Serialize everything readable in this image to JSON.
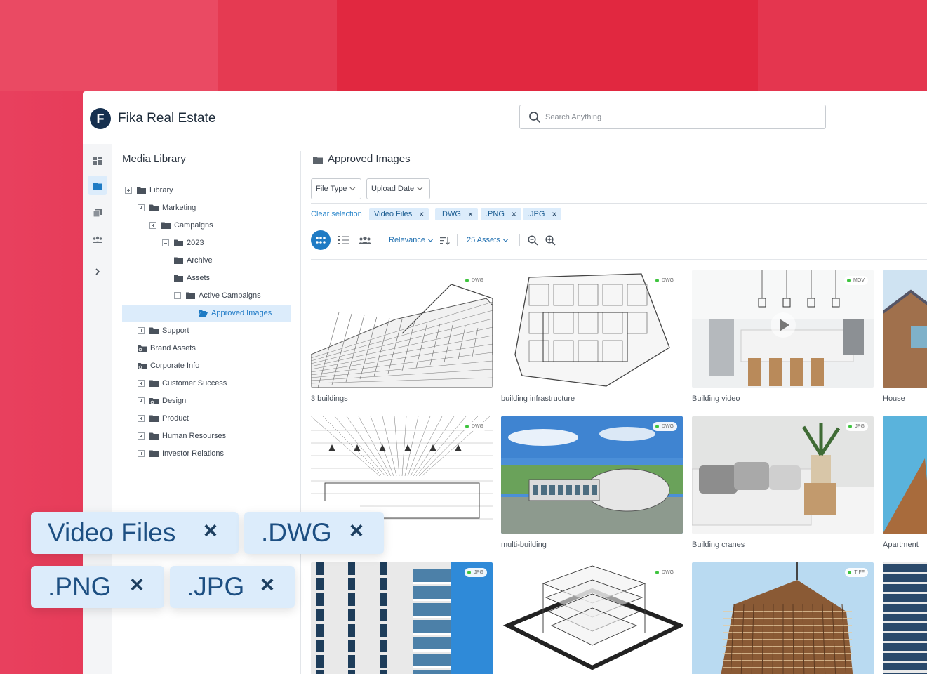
{
  "app": {
    "logo_letter": "F",
    "brand": "Fika Real Estate"
  },
  "search": {
    "placeholder": "Search Anything"
  },
  "rail": {
    "icons": [
      "dashboard-icon",
      "folder-icon",
      "collections-icon",
      "users-icon",
      "chevron-right-icon"
    ]
  },
  "tree": {
    "title": "Media Library",
    "items": [
      {
        "label": "Library",
        "level": 0,
        "expander": true,
        "icon": "folder"
      },
      {
        "label": "Marketing",
        "level": 1,
        "expander": true,
        "icon": "folder"
      },
      {
        "label": "Campaigns",
        "level": 2,
        "expander": true,
        "icon": "folder"
      },
      {
        "label": "2023",
        "level": 3,
        "expander": true,
        "icon": "folder"
      },
      {
        "label": "Archive",
        "level": 4,
        "expander": false,
        "icon": "folder"
      },
      {
        "label": "Assets",
        "level": 4,
        "expander": false,
        "icon": "folder"
      },
      {
        "label": "Active Campaigns",
        "level": 4,
        "expander": true,
        "icon": "folder"
      },
      {
        "label": "Approved Images",
        "level": 5,
        "expander": false,
        "icon": "folder-open",
        "selected": true
      },
      {
        "label": "Support",
        "level": 1,
        "expander": true,
        "icon": "folder"
      },
      {
        "label": "Brand Assets",
        "level": 1,
        "expander": false,
        "icon": "shared-folder"
      },
      {
        "label": "Corporate Info",
        "level": 1,
        "expander": false,
        "icon": "shared-folder"
      },
      {
        "label": "Customer Success",
        "level": 1,
        "expander": true,
        "icon": "folder"
      },
      {
        "label": "Design",
        "level": 1,
        "expander": true,
        "icon": "shared-folder"
      },
      {
        "label": "Product",
        "level": 1,
        "expander": true,
        "icon": "folder"
      },
      {
        "label": "Human Resourses",
        "level": 1,
        "expander": true,
        "icon": "folder"
      },
      {
        "label": "Investor Relations",
        "level": 1,
        "expander": true,
        "icon": "folder"
      }
    ]
  },
  "main": {
    "title": "Approved Images",
    "filters": {
      "file_type": "File Type",
      "upload_date": "Upload Date"
    },
    "clear_selection": "Clear selection",
    "chips": [
      "Video Files",
      ".DWG",
      ".PNG",
      ".JPG"
    ],
    "chip_close": "×",
    "sort": "Relevance",
    "asset_count": "25 Assets"
  },
  "assets": [
    {
      "caption": "3 buildings",
      "format": "DWG",
      "kind": "sketch-building"
    },
    {
      "caption": "building infrastructure",
      "format": "DWG",
      "kind": "sketch-plan"
    },
    {
      "caption": "Building video",
      "format": "MOV",
      "kind": "kitchen"
    },
    {
      "caption": "House",
      "format": "",
      "kind": "house"
    },
    {
      "caption": "",
      "format": "DWG",
      "kind": "sketch-interior"
    },
    {
      "caption": "multi-building",
      "format": "DWG",
      "kind": "render-campus"
    },
    {
      "caption": "Building cranes",
      "format": "JPG",
      "kind": "bedroom"
    },
    {
      "caption": "Apartment",
      "format": "",
      "kind": "sky"
    },
    {
      "caption": "",
      "format": "JPG",
      "kind": "facade"
    },
    {
      "caption": "",
      "format": "DWG",
      "kind": "sketch-3d"
    },
    {
      "caption": "",
      "format": "TIFF",
      "kind": "tower"
    },
    {
      "caption": "",
      "format": "",
      "kind": "glass"
    }
  ],
  "overlay_chips": [
    "Video Files",
    ".DWG",
    ".PNG",
    ".JPG"
  ],
  "colors": {
    "accent": "#1f7bc4",
    "chip_bg": "#dcecfb",
    "brand_dark": "#16304f",
    "background": "#e12a40"
  }
}
